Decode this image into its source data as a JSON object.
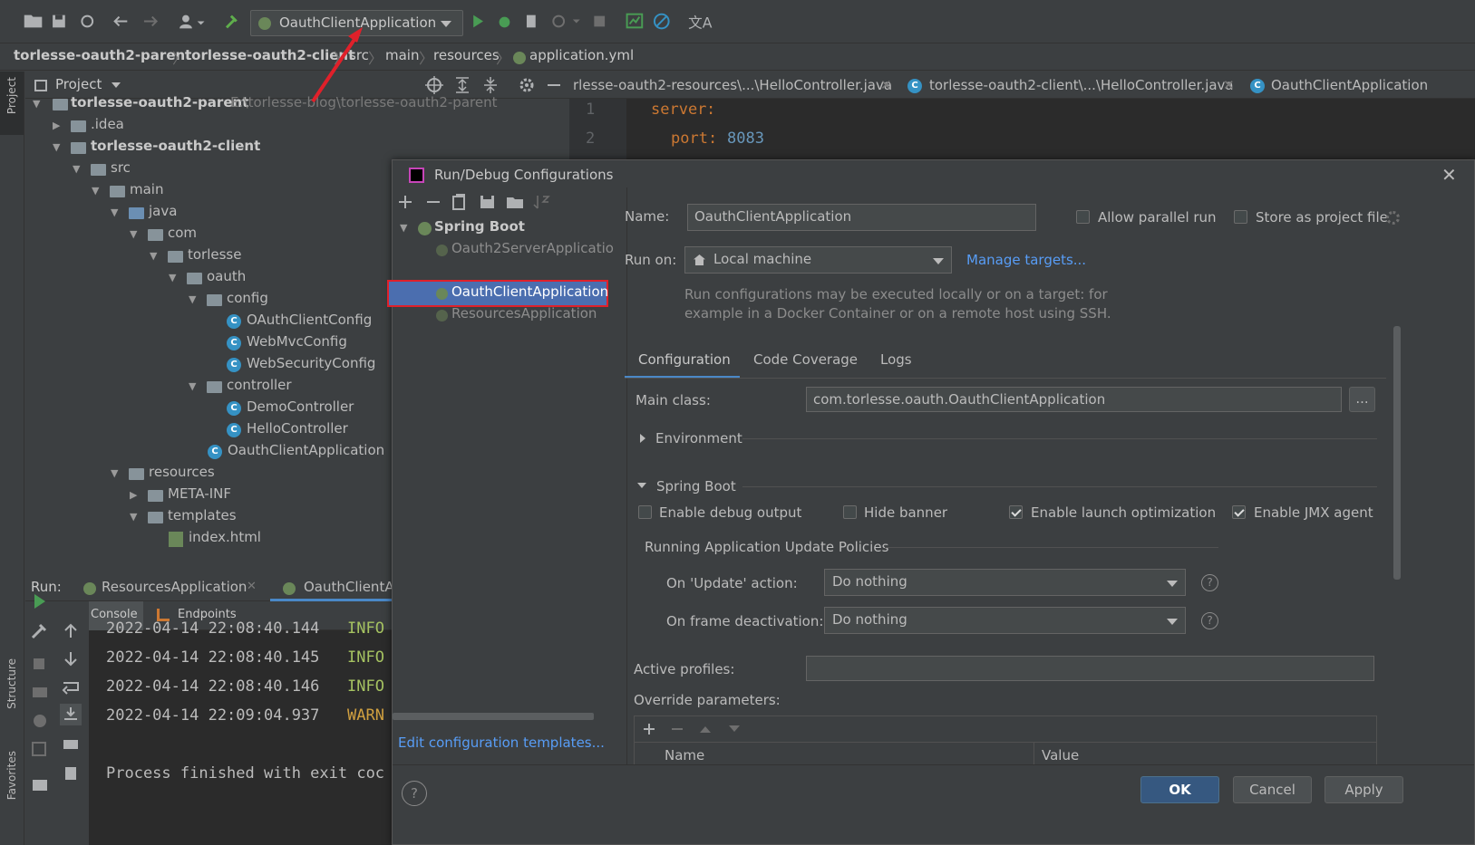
{
  "toolbar": {
    "run_config": "OauthClientApplication"
  },
  "breadcrumb": [
    "torlesse-oauth2-parent",
    "torlesse-oauth2-client",
    "src",
    "main",
    "resources",
    "application.yml"
  ],
  "left_strip": {
    "project": "Project",
    "structure": "Structure",
    "favorites": "Favorites"
  },
  "project_panel": {
    "title": "Project",
    "tree": [
      {
        "label": "torlesse-oauth2-parent",
        "path": "E:\\torlesse-blog\\torlesse-oauth2-parent"
      },
      {
        "label": ".idea"
      },
      {
        "label": "torlesse-oauth2-client"
      },
      {
        "label": "src"
      },
      {
        "label": "main"
      },
      {
        "label": "java"
      },
      {
        "label": "com"
      },
      {
        "label": "torlesse"
      },
      {
        "label": "oauth"
      },
      {
        "label": "config"
      },
      {
        "label": "OAuthClientConfig"
      },
      {
        "label": "WebMvcConfig"
      },
      {
        "label": "WebSecurityConfig"
      },
      {
        "label": "controller"
      },
      {
        "label": "DemoController"
      },
      {
        "label": "HelloController"
      },
      {
        "label": "OauthClientApplication"
      },
      {
        "label": "resources"
      },
      {
        "label": "META-INF"
      },
      {
        "label": "templates"
      },
      {
        "label": "index.html"
      }
    ]
  },
  "editor": {
    "tabs": [
      "rlesse-oauth2-resources\\...\\HelloController.java",
      "torlesse-oauth2-client\\...\\HelloController.java",
      "OauthClientApplication"
    ],
    "lines": [
      {
        "num": "1",
        "key": "server",
        "colon": ":"
      },
      {
        "num": "2",
        "key": "port",
        "colon": ":",
        "value": "8083"
      }
    ]
  },
  "run_panel": {
    "label": "Run:",
    "tab1": "ResourcesApplication",
    "tab2": "OauthClientA",
    "console": "Console",
    "endpoints": "Endpoints",
    "logs": [
      {
        "time": "2022-04-14 22:08:40.144",
        "level": "INFO"
      },
      {
        "time": "2022-04-14 22:08:40.145",
        "level": "INFO"
      },
      {
        "time": "2022-04-14 22:08:40.146",
        "level": "INFO"
      },
      {
        "time": "2022-04-14 22:09:04.937",
        "level": "WARN"
      }
    ],
    "finished": "Process finished with exit coc"
  },
  "dialog": {
    "title": "Run/Debug Configurations",
    "tree_group": "Spring Boot",
    "tree_items": [
      "Oauth2ServerApplicatio",
      "OauthClientApplication",
      "ResourcesApplication"
    ],
    "edit_templates": "Edit configuration templates...",
    "name_label": "Name:",
    "name_value": "OauthClientApplication",
    "allow_parallel": "Allow parallel run",
    "store_project": "Store as project file",
    "run_on_label": "Run on:",
    "run_on_value": "Local machine",
    "manage_targets": "Manage targets...",
    "run_on_hint_1": "Run configurations may be executed locally or on a target: for",
    "run_on_hint_2": "example in a Docker Container or on a remote host using SSH.",
    "tabs": [
      "Configuration",
      "Code Coverage",
      "Logs"
    ],
    "main_class_label": "Main class:",
    "main_class_value": "com.torlesse.oauth.OauthClientApplication",
    "browse": "...",
    "environment": "Environment",
    "spring_boot": "Spring Boot",
    "enable_debug": "Enable debug output",
    "hide_banner": "Hide banner",
    "enable_launch": "Enable launch optimization",
    "enable_jmx": "Enable JMX agent",
    "update_policies": "Running Application Update Policies",
    "on_update_label": "On 'Update' action:",
    "on_update_value": "Do nothing",
    "on_frame_label": "On frame deactivation:",
    "on_frame_value": "Do nothing",
    "active_profiles": "Active profiles:",
    "override_params": "Override parameters:",
    "col_name": "Name",
    "col_value": "Value",
    "ok": "OK",
    "cancel": "Cancel",
    "apply": "Apply",
    "help": "?"
  },
  "colors": {
    "accent": "#365880",
    "selection": "#4b6eaf",
    "highlight_box": "#e0202a",
    "yaml_key": "#cc7832",
    "yaml_number": "#6897bb",
    "log_info": "#a5c261",
    "log_warn": "#d0a040"
  }
}
